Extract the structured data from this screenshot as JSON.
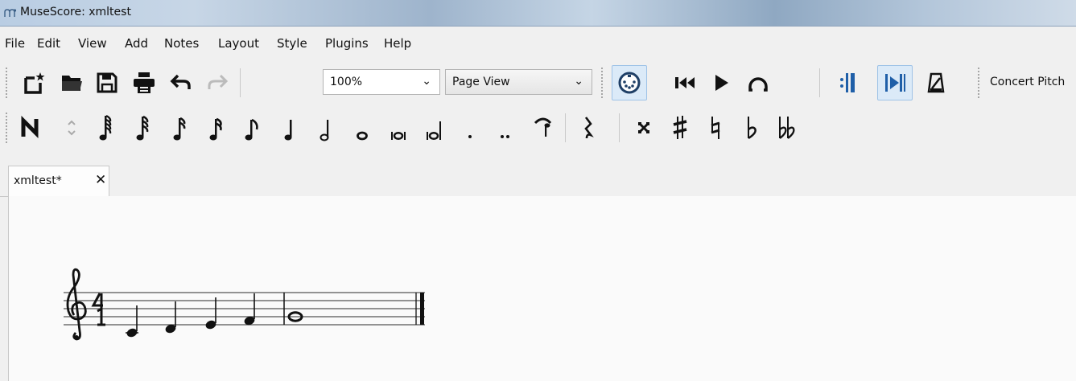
{
  "window": {
    "title": "MuseScore: xmltest"
  },
  "menu": [
    "File",
    "Edit",
    "View",
    "Add",
    "Notes",
    "Layout",
    "Style",
    "Plugins",
    "Help"
  ],
  "toolbar": {
    "zoom_value": "100%",
    "view_mode_value": "Page View",
    "concert_pitch_label": "Concert Pitch",
    "icons": [
      "new-score-icon",
      "open-folder-icon",
      "save-icon",
      "print-icon",
      "undo-icon",
      "redo-icon",
      "midi-input-icon",
      "rewind-icon",
      "play-icon",
      "loop-icon",
      "repeat-icon",
      "pan-icon",
      "metronome-icon"
    ]
  },
  "note_input": {
    "durations": [
      "128th",
      "64th",
      "32nd",
      "16th",
      "eighth",
      "quarter",
      "half",
      "whole",
      "breve",
      "longa",
      "augmentation dot",
      "double dot"
    ],
    "accidentals": [
      "double sharp",
      "sharp",
      "natural",
      "flat",
      "double flat"
    ]
  },
  "document_tab": {
    "label": "xmltest*",
    "close_symbol": "✕"
  },
  "score": {
    "clef": "treble",
    "time_signature": "4/4",
    "measure1_notes": [
      "C4 quarter",
      "D4 quarter",
      "E4 quarter",
      "F4 quarter"
    ],
    "measure2_notes": [
      "G4 whole"
    ]
  }
}
